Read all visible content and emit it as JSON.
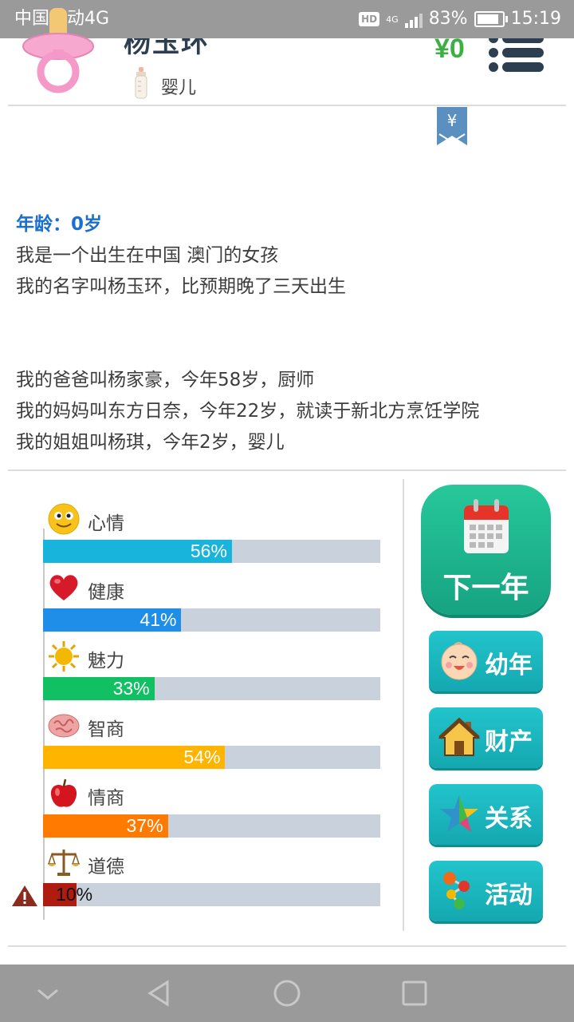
{
  "status_bar": {
    "carrier": "中国移动4G",
    "network": "4G",
    "battery": "83%",
    "time": "15:19"
  },
  "profile": {
    "name": "杨玉环",
    "life_stage": "婴儿",
    "money": "¥0"
  },
  "bookmark_symbol": "¥",
  "story": {
    "age": "年龄：0岁",
    "lines1": [
      "我是一个出生在中国 澳门的女孩",
      "我的名字叫杨玉环，比预期晚了三天出生"
    ],
    "lines2": [
      "我的爸爸叫杨家豪，今年58岁，厨师",
      "我的妈妈叫东方日奈，今年22岁，就读于新北方烹饪学院",
      "我的姐姐叫杨琪，今年2岁，婴儿"
    ]
  },
  "stats": [
    {
      "label": "心情",
      "percent": 56,
      "text": "56%",
      "color": "#18b4dc",
      "icon": "smiley-icon"
    },
    {
      "label": "健康",
      "percent": 41,
      "text": "41%",
      "color": "#1e8ee8",
      "icon": "heart-icon"
    },
    {
      "label": "魅力",
      "percent": 33,
      "text": "33%",
      "color": "#10c062",
      "icon": "sun-icon"
    },
    {
      "label": "智商",
      "percent": 54,
      "text": "54%",
      "color": "#ffb400",
      "icon": "brain-icon"
    },
    {
      "label": "情商",
      "percent": 37,
      "text": "37%",
      "color": "#ff7a00",
      "icon": "apple-icon"
    },
    {
      "label": "道德",
      "percent": 10,
      "text": "10%",
      "color": "#b01b0f",
      "icon": "scales-icon"
    }
  ],
  "actions": {
    "next_year": "下一年",
    "childhood": "幼年",
    "property": "财产",
    "relations": "关系",
    "activities": "活动"
  },
  "colors": {
    "money": "#3cb043",
    "age": "#1a6fd0",
    "next_button": "#1bb58d",
    "side_button": "#1ab8c0",
    "track": "#c8d1dc"
  }
}
